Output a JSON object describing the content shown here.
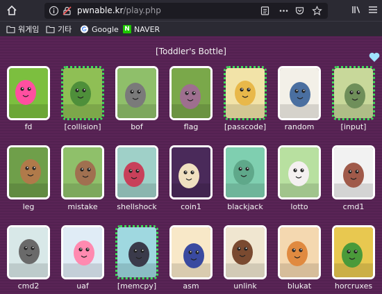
{
  "browser": {
    "url_host": "pwnable.kr",
    "url_path": "/play.php"
  },
  "bookmarks": [
    {
      "label": "워게임",
      "icon": "folder-icon"
    },
    {
      "label": "기타",
      "icon": "folder-icon"
    },
    {
      "label": "Google",
      "icon": "google-icon"
    },
    {
      "label": "NAVER",
      "icon": "naver-icon"
    }
  ],
  "section_title": "[Toddler's Bottle]",
  "challenges": [
    {
      "label": "fd",
      "solved": false,
      "bg": "#7cbf3f",
      "fg": "#ff4fa0"
    },
    {
      "label": "[collision]",
      "solved": true,
      "bg": "#8fbf55",
      "fg": "#4e8f3a"
    },
    {
      "label": "bof",
      "solved": false,
      "bg": "#8fbf6a",
      "fg": "#7a7a7a"
    },
    {
      "label": "flag",
      "solved": false,
      "bg": "#7aa84a",
      "fg": "#9e6f8f"
    },
    {
      "label": "[passcode]",
      "solved": true,
      "bg": "#f2e3a8",
      "fg": "#e8b84a"
    },
    {
      "label": "random",
      "solved": false,
      "bg": "#f3f0e8",
      "fg": "#4a6fa0"
    },
    {
      "label": "[input]",
      "solved": true,
      "bg": "#c8d89a",
      "fg": "#6f8f5a"
    },
    {
      "label": "leg",
      "solved": false,
      "bg": "#6f9f4a",
      "fg": "#b07a4a"
    },
    {
      "label": "mistake",
      "solved": false,
      "bg": "#8fc06a",
      "fg": "#a07050"
    },
    {
      "label": "shellshock",
      "solved": false,
      "bg": "#9fd0c8",
      "fg": "#c8405a"
    },
    {
      "label": "coin1",
      "solved": false,
      "bg": "#4a2a5a",
      "fg": "#f0e0c0"
    },
    {
      "label": "blackjack",
      "solved": false,
      "bg": "#7fcfb0",
      "fg": "#5fa88a"
    },
    {
      "label": "lotto",
      "solved": false,
      "bg": "#b8e0a0",
      "fg": "#f4f0f0"
    },
    {
      "label": "cmd1",
      "solved": false,
      "bg": "#f2f2f2",
      "fg": "#a05a4a"
    },
    {
      "label": "cmd2",
      "solved": false,
      "bg": "#d8e8e8",
      "fg": "#6a6a6a"
    },
    {
      "label": "uaf",
      "solved": false,
      "bg": "#e0ecf6",
      "fg": "#ff8ab0"
    },
    {
      "label": "[memcpy]",
      "solved": true,
      "bg": "#9fd8e0",
      "fg": "#3a3a4a"
    },
    {
      "label": "asm",
      "solved": false,
      "bg": "#f8e8c8",
      "fg": "#3a4aa0"
    },
    {
      "label": "unlink",
      "solved": false,
      "bg": "#f0e6d0",
      "fg": "#7a4a30"
    },
    {
      "label": "blukat",
      "solved": false,
      "bg": "#f4d8b0",
      "fg": "#e08a40"
    },
    {
      "label": "horcruxes",
      "solved": false,
      "bg": "#e8c850",
      "fg": "#4a9a3a"
    }
  ]
}
